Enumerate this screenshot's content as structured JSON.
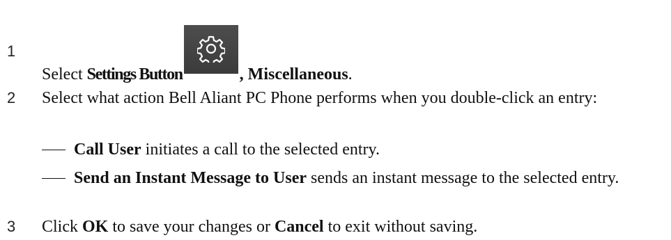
{
  "steps": [
    {
      "number": "1",
      "prefix": "Select ",
      "bold": "Settings Button",
      "icon": "gear-icon",
      "suffix_bold": ", Miscellaneous",
      "suffix": "."
    },
    {
      "number": "2",
      "text": "Select what action Bell Aliant PC Phone performs when you double-click an entry:",
      "options": [
        {
          "bold": "Call User",
          "text": " initiates a call to the selected entry."
        },
        {
          "bold": "Send an Instant Message to User",
          "text": " sends an instant message to the selected entry."
        }
      ]
    },
    {
      "number": "3",
      "t1": "Click ",
      "ok": "OK",
      "t2": " to save your changes or ",
      "cancel": "Cancel",
      "t3": " to exit without saving."
    }
  ],
  "colors": {
    "icon_bg": "#444444",
    "icon_fg": "#ffffff"
  }
}
